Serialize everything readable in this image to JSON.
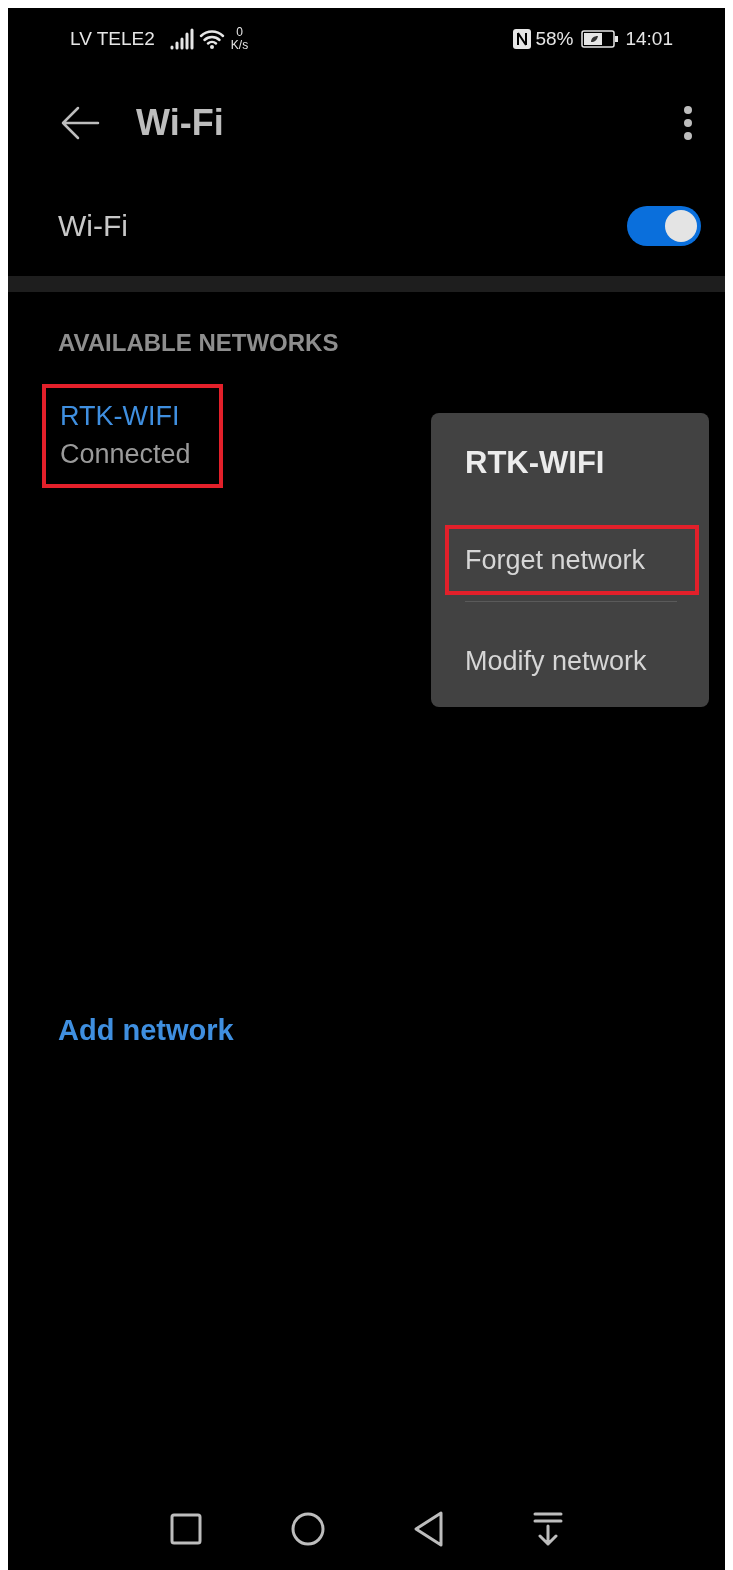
{
  "status_bar": {
    "carrier": "LV TELE2",
    "speed_value": "0",
    "speed_unit": "K/s",
    "battery": "58%",
    "time": "14:01"
  },
  "app_bar": {
    "title": "Wi-Fi"
  },
  "wifi_toggle": {
    "label": "Wi-Fi",
    "on": true
  },
  "section_header": "AVAILABLE NETWORKS",
  "networks": [
    {
      "name": "RTK-WIFI",
      "status": "Connected",
      "highlighted": true
    }
  ],
  "context_menu": {
    "title": "RTK-WIFI",
    "items": [
      {
        "label": "Forget network",
        "highlighted": true
      },
      {
        "label": "Modify network",
        "highlighted": false
      }
    ]
  },
  "add_network": "Add network"
}
